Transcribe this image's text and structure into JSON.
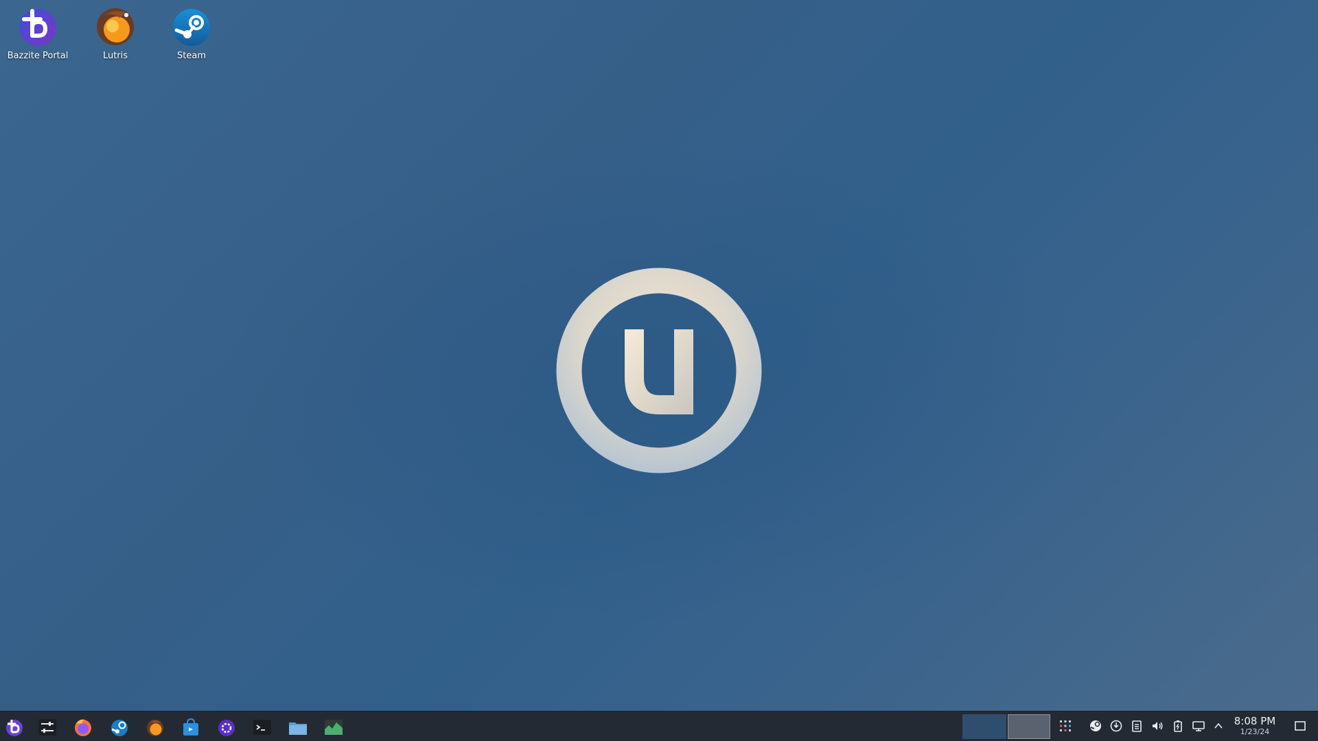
{
  "desktop": {
    "icons": [
      {
        "label": "Bazzite Portal",
        "icon": "bazzite-portal-icon"
      },
      {
        "label": "Lutris",
        "icon": "lutris-icon"
      },
      {
        "label": "Steam",
        "icon": "steam-icon"
      }
    ],
    "wallpaper_logo": "u-circle-logo"
  },
  "taskbar": {
    "launcher_icon": "bazzite-launcher-icon",
    "pinned_apps": [
      {
        "name": "System Settings",
        "icon": "settings-sliders-icon"
      },
      {
        "name": "Firefox",
        "icon": "firefox-icon"
      },
      {
        "name": "Steam",
        "icon": "steam-icon"
      },
      {
        "name": "Lutris",
        "icon": "lutris-icon"
      },
      {
        "name": "Discover",
        "icon": "discover-store-icon"
      },
      {
        "name": "Bazzite Portal",
        "icon": "bazzite-portal-icon"
      },
      {
        "name": "Terminal",
        "icon": "terminal-icon"
      },
      {
        "name": "Files",
        "icon": "folder-icon"
      },
      {
        "name": "System Monitor",
        "icon": "system-monitor-icon"
      }
    ],
    "pager": {
      "desktops": 2,
      "active": 2
    },
    "tray_icons": [
      "app-grid-icon",
      "steam-tray-icon",
      "update-icon",
      "clipboard-icon",
      "volume-icon",
      "battery-icon",
      "network-icon",
      "expand-tray-icon"
    ],
    "clock": {
      "time": "8:08 PM",
      "date": "1/23/24"
    },
    "show_desktop_icon": "show-desktop-icon"
  },
  "colors": {
    "taskbar_bg": "#242a33",
    "wallpaper_base": "#365f88",
    "bazzite_purple": "#6b3fd6",
    "lutris_orange": "#f59a1c",
    "steam_blue": "#1a6fb5"
  }
}
